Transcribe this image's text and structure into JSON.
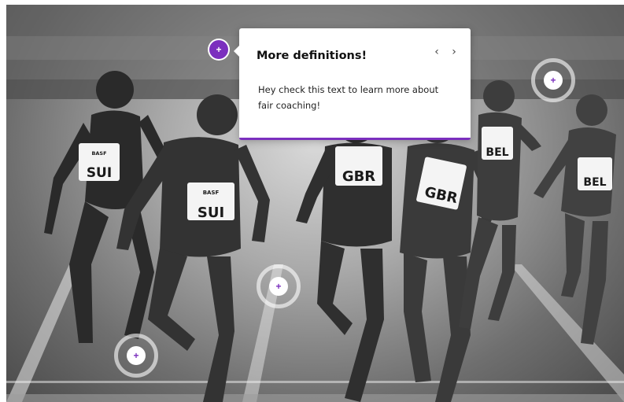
{
  "popover": {
    "title": "More definitions!",
    "body": "Hey check this text to learn more about fair coaching!",
    "prev_icon": "chevron-left-icon",
    "next_icon": "chevron-right-icon"
  },
  "hotspots": [
    {
      "name": "hotspot-active",
      "glyph": "+",
      "state": "active"
    },
    {
      "name": "hotspot-top-right",
      "glyph": "+",
      "state": "idle"
    },
    {
      "name": "hotspot-center",
      "glyph": "+",
      "state": "idle"
    },
    {
      "name": "hotspot-bottom-left",
      "glyph": "+",
      "state": "idle"
    }
  ],
  "bibs": [
    "SUI",
    "SUI",
    "GBR",
    "GBR",
    "BEL",
    "BEL"
  ],
  "sponsor": "BASF",
  "colors": {
    "accent": "#7b2fbe",
    "popover_bg": "#ffffff",
    "ring": "rgba(255,255,255,0.6)"
  }
}
